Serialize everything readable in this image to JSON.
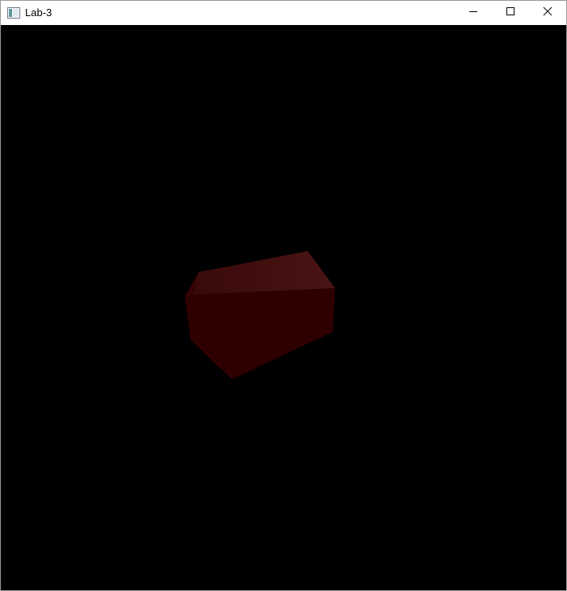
{
  "window": {
    "title": "Lab-3",
    "app_icon": "window-app-icon",
    "buttons": [
      {
        "name": "minimize",
        "icon": "minimize-icon"
      },
      {
        "name": "maximize",
        "icon": "maximize-icon"
      },
      {
        "name": "close",
        "icon": "close-icon"
      }
    ]
  },
  "viewport": {
    "background": "#000000",
    "object": "3d-prism",
    "colors": {
      "top_face_dark": "#3a0a0a",
      "top_face_light": "#4a1414",
      "front_face": "#2f0000",
      "left_face": "#360404"
    }
  }
}
